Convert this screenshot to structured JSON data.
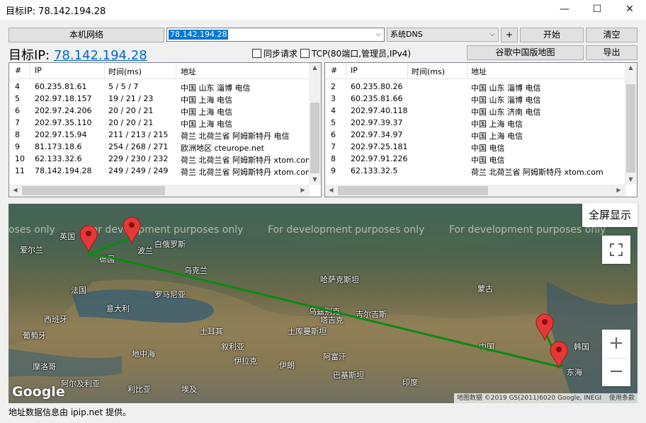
{
  "window": {
    "title": "目标IP: 78.142.194.28",
    "minimize": "—",
    "maximize": "☐",
    "close": "✕"
  },
  "toolbar": {
    "local_network": "本机网络",
    "target_input": "78.142.194.28",
    "dns_select": "系统DNS",
    "add": "+",
    "start": "开始",
    "clear": "清空",
    "google_map": "谷歌中国版地图",
    "export": "导出",
    "sync_request": "同步请求",
    "tcp_option": "TCP(80端口,管理员,IPv4)"
  },
  "target": {
    "label": "目标IP: ",
    "ip": "78.142.194.28"
  },
  "left_table": {
    "headers": [
      "#",
      "IP",
      "时间(ms)",
      "地址"
    ],
    "rows": [
      [
        "4",
        "60.235.81.61",
        "5 / 5 / 7",
        "中国 山东 淄博 电信"
      ],
      [
        "5",
        "202.97.18.157",
        "19 / 21 / 23",
        "中国 上海 电信"
      ],
      [
        "6",
        "202.97.24.206",
        "20 / 20 / 21",
        "中国 上海 电信"
      ],
      [
        "7",
        "202.97.35.110",
        "20 / 20 / 21",
        "中国 上海 电信"
      ],
      [
        "8",
        "202.97.15.94",
        "211 / 213 / 215",
        "荷兰 北荷兰省 阿姆斯特丹 电信"
      ],
      [
        "9",
        "81.173.18.6",
        "254 / 268 / 271",
        "欧洲地区 cteurope.net"
      ],
      [
        "10",
        "62.133.32.6",
        "229 / 230 / 232",
        "荷兰 北荷兰省 阿姆斯特丹 xtom.com"
      ],
      [
        "11",
        "78.142.194.28",
        "249 / 249 / 249",
        "荷兰 北荷兰省 阿姆斯特丹 xtom.com"
      ]
    ]
  },
  "right_table": {
    "headers": [
      "#",
      "IP",
      "时间(ms)",
      "地址"
    ],
    "rows": [
      [
        "2",
        "60.235.80.26",
        "",
        "中国 山东 淄博 电信"
      ],
      [
        "3",
        "60.235.81.66",
        "",
        "中国 山东 淄博 电信"
      ],
      [
        "4",
        "202.97.40.118",
        "",
        "中国 山东 济南 电信"
      ],
      [
        "5",
        "202.97.39.37",
        "",
        "中国 上海 电信"
      ],
      [
        "6",
        "202.97.34.97",
        "",
        "中国 上海 电信"
      ],
      [
        "7",
        "202.97.25.181",
        "",
        "中国 电信"
      ],
      [
        "8",
        "202.97.91.226",
        "",
        "中国 电信"
      ],
      [
        "9",
        "62.133.32.5",
        "",
        "荷兰 北荷兰省 阿姆斯特丹 xtom.com"
      ]
    ]
  },
  "map": {
    "watermark": "For development purposes only",
    "watermark_partial": "oses only",
    "fullscreen_label": "全屏显示",
    "zoom_in": "+",
    "zoom_out": "−",
    "attribution": "地图数据 ©2019 GS(2011)6020 Google, INEGI",
    "terms": "使用条款",
    "google_logo": "Google",
    "places": {
      "uk": "英国",
      "ireland": "爱尔兰",
      "poland": "波兰",
      "belarus": "白俄罗斯",
      "germany": "德国",
      "ukraine": "乌克兰",
      "kazakhstan": "哈萨克斯坦",
      "mongolia": "蒙古",
      "france": "法国",
      "romania": "罗马尼亚",
      "italy": "意大利",
      "spain": "西班牙",
      "portugal": "葡萄牙",
      "turkey": "土耳其",
      "turkmenistan": "土库曼斯坦",
      "uzbekistan": "乌兹别克",
      "kyrgyzstan": "吉尔吉斯",
      "tajikistan": "塔吉克",
      "china": "中国",
      "afghanistan": "阿富汗",
      "iran": "伊朗",
      "iraq": "伊拉克",
      "pakistan": "巴基斯坦",
      "syria": "叙利亚",
      "morocco": "摩洛哥",
      "algeria": "阿尔及利亚",
      "libya": "利比亚",
      "egypt": "埃及",
      "india": "印度",
      "korea": "韩国",
      "east_sea": "东海",
      "med": "地中海"
    }
  },
  "footer": "地址数据信息由 ipip.net 提供。"
}
